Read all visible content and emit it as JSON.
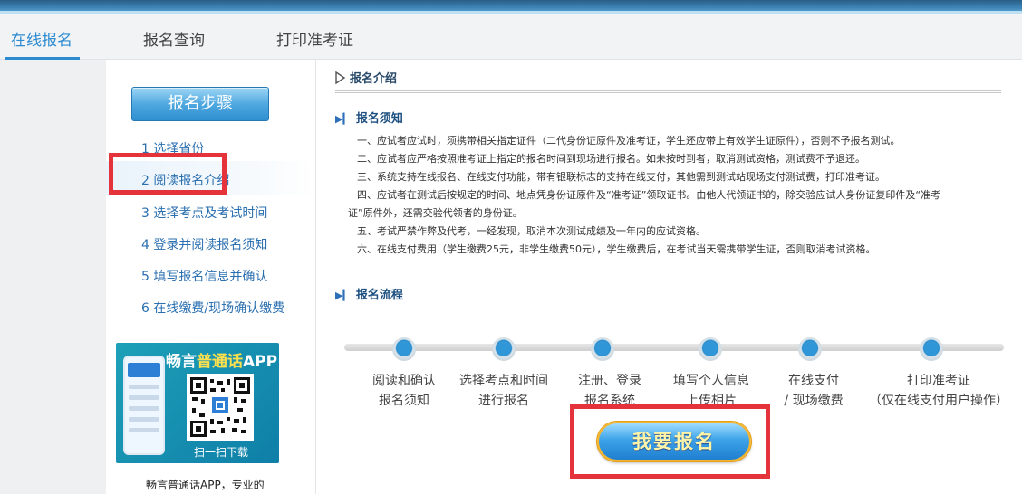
{
  "nav": {
    "tabs": [
      {
        "label": "在线报名"
      },
      {
        "label": "报名查询"
      },
      {
        "label": "打印准考证"
      }
    ]
  },
  "sidebar": {
    "steps_button": "报名步骤",
    "steps": [
      {
        "label": "1 选择省份"
      },
      {
        "label": "2 阅读报名介绍"
      },
      {
        "label": "3 选择考点及考试时间"
      },
      {
        "label": "4 登录并阅读报名须知"
      },
      {
        "label": "5 填写报名信息并确认"
      },
      {
        "label": "6 在线缴费/现场确认缴费"
      }
    ],
    "app": {
      "title_a": "畅言",
      "title_b": "普通话",
      "title_c": "APP",
      "scan": "扫一扫下载",
      "desc": "畅言普通话APP，专业的"
    }
  },
  "content": {
    "section_title": "报名介绍",
    "notice_title": "报名须知",
    "notice": [
      "一、应试者应试时，须携带相关指定证件（二代身份证原件及准考证，学生还应带上有效学生证原件），否则不予报名测试。",
      "二、应试者应严格按照准考证上指定的报名时间到现场进行报名。如未按时到者，取消测试资格，测试费不予退还。",
      "三、系统支持在线报名、在线支付功能，带有银联标志的支持在线支付，其他需到测试站现场支付测试费，打印准考证。",
      "四、应试者在测试后按规定的时间、地点凭身份证原件及“准考证”领取证书。由他人代领证书的，除交验应试人身份证复印件及“准考",
      "证”原件外，还需交验代领者的身份证。",
      "五、考试严禁作弊及代考，一经发现，取消本次测试成绩及一年内的应试资格。",
      "六、在线支付费用（学生缴费25元，非学生缴费50元），学生缴费后，在考试当天需携带学生证，否则取消考试资格。"
    ],
    "flow_title": "报名流程",
    "flow": [
      {
        "line1": "阅读和确认",
        "line2": "报名须知"
      },
      {
        "line1": "选择考点和时间",
        "line2": "进行报名"
      },
      {
        "line1": "注册、登录",
        "line2": "报名系统"
      },
      {
        "line1": "填写个人信息",
        "line2": "上传相片"
      },
      {
        "line1": "在线支付",
        "line2": "/ 现场缴费"
      },
      {
        "line1": "打印准考证",
        "line2": "（仅在线支付用户操作）"
      }
    ],
    "signup_button": "我要报名"
  }
}
